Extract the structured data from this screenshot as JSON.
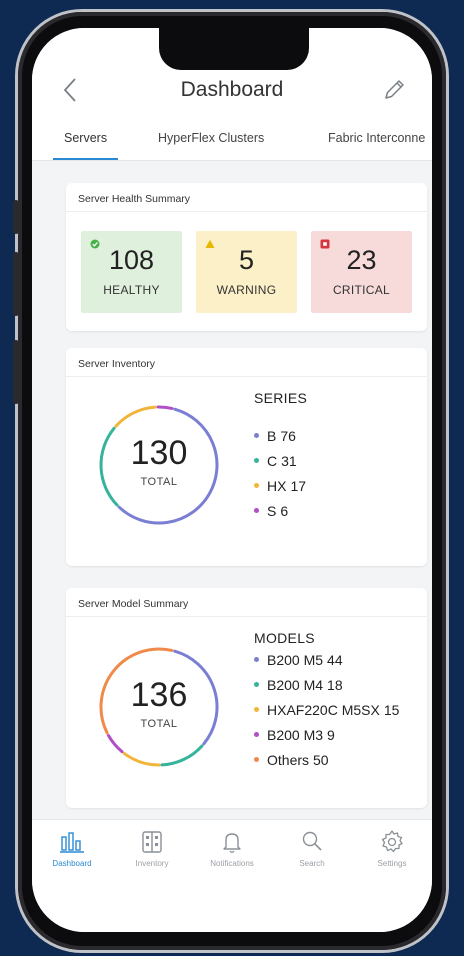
{
  "header": {
    "title": "Dashboard"
  },
  "tabs": [
    {
      "label": "Servers",
      "active": true
    },
    {
      "label": "HyperFlex Clusters",
      "active": false
    },
    {
      "label": "Fabric Interconne",
      "active": false
    }
  ],
  "health": {
    "title": "Server Health Summary",
    "items": [
      {
        "count": "108",
        "label": "HEALTHY",
        "bg": "#dff0dc",
        "icon_color": "#46b04a",
        "icon": "check-circle-icon"
      },
      {
        "count": "5",
        "label": "WARNING",
        "bg": "#fbf0c8",
        "icon_color": "#e8b800",
        "icon": "warning-triangle-icon"
      },
      {
        "count": "23",
        "label": "CRITICAL",
        "bg": "#f7dada",
        "icon_color": "#d8343b",
        "icon": "critical-square-icon"
      }
    ]
  },
  "inventory": {
    "title": "Server Inventory",
    "total": "130",
    "total_label": "TOTAL",
    "legend_title": "SERIES",
    "items": [
      {
        "name": "B",
        "value": "76",
        "color": "#7b7fd4"
      },
      {
        "name": "C",
        "value": "31",
        "color": "#36b39a"
      },
      {
        "name": "HX",
        "value": "17",
        "color": "#f0b53a"
      },
      {
        "name": "S",
        "value": "6",
        "color": "#b04fc7"
      }
    ]
  },
  "models": {
    "title": "Server Model Summary",
    "total": "136",
    "total_label": "TOTAL",
    "legend_title": "MODELS",
    "items": [
      {
        "name": "B200 M5",
        "value": "44",
        "color": "#7b7fd4"
      },
      {
        "name": "B200 M4",
        "value": "18",
        "color": "#36b39a"
      },
      {
        "name": "HXAF220C M5SX",
        "value": "15",
        "color": "#f0b53a"
      },
      {
        "name": "B200 M3",
        "value": "9",
        "color": "#b04fc7"
      },
      {
        "name": "Others",
        "value": "50",
        "color": "#f08a4b"
      }
    ]
  },
  "tabbar": [
    {
      "label": "Dashboard",
      "icon": "bar-chart-icon",
      "active": true
    },
    {
      "label": "Inventory",
      "icon": "server-rack-icon",
      "active": false
    },
    {
      "label": "Notifications",
      "icon": "bell-icon",
      "active": false
    },
    {
      "label": "Search",
      "icon": "search-icon",
      "active": false
    },
    {
      "label": "Settings",
      "icon": "gear-icon",
      "active": false
    }
  ],
  "colors": {
    "accent": "#2a8ad3",
    "background": "#0e2a52"
  }
}
